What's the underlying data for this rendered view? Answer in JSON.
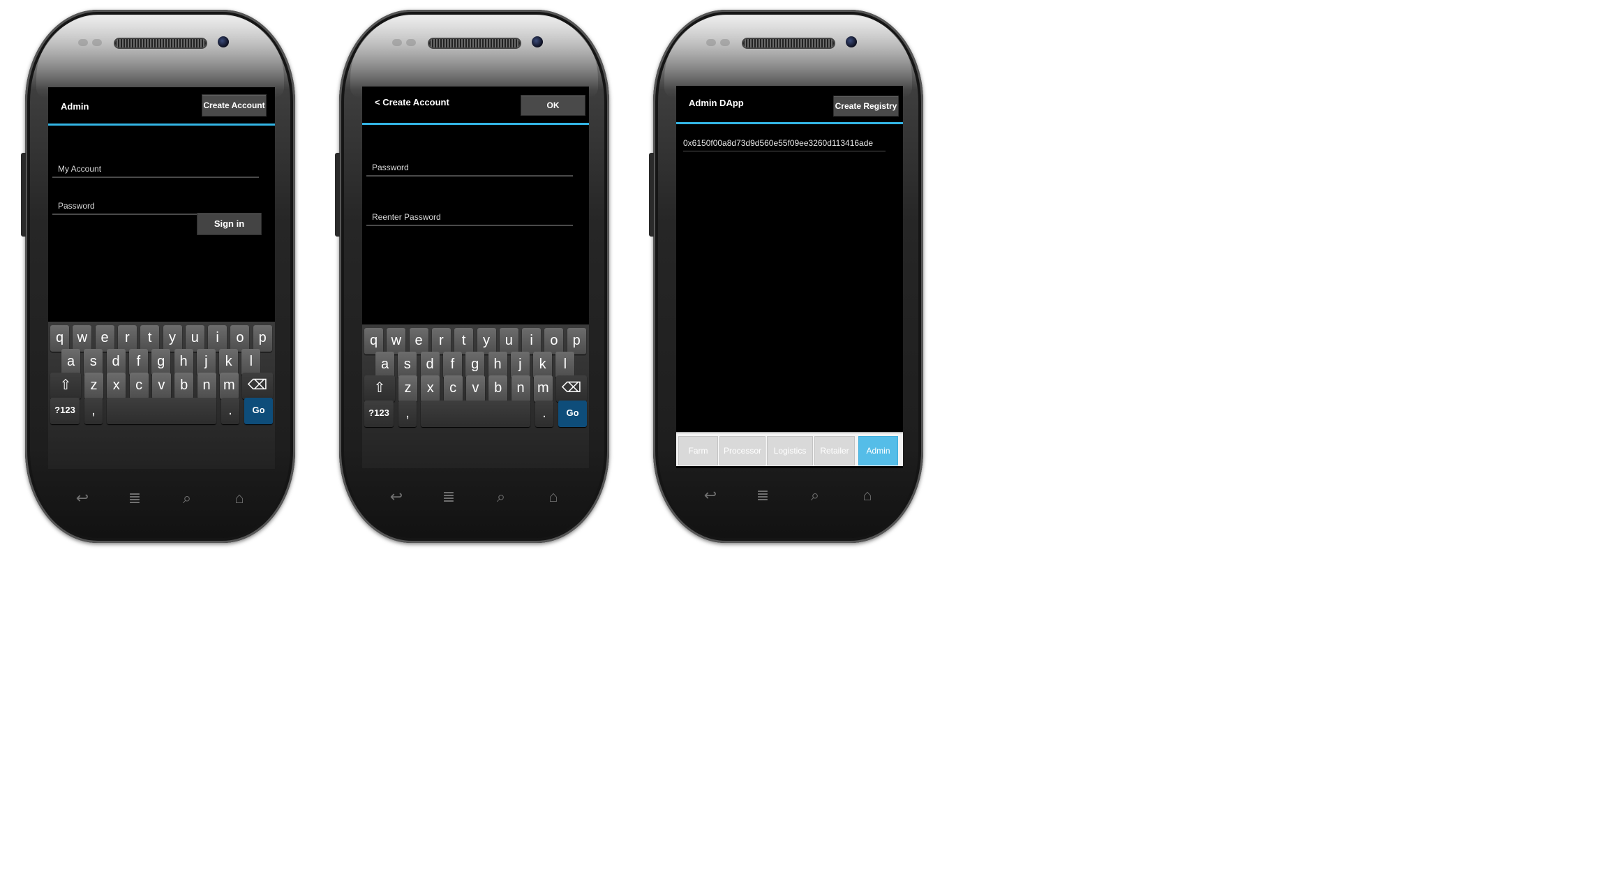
{
  "phone1": {
    "title": "Admin",
    "create_account_label": "Create Account",
    "account_placeholder": "My Account",
    "password_placeholder": "Password",
    "signin_label": "Sign in"
  },
  "phone2": {
    "title": "< Create Account",
    "ok_label": "OK",
    "password_placeholder": "Password",
    "reenter_placeholder": "Reenter Password"
  },
  "phone3": {
    "title": "Admin DApp",
    "create_registry_label": "Create Registry",
    "address": "0x6150f00a8d73d9d560e55f09ee3260d113416ade",
    "tabs": [
      "Farm",
      "Processor",
      "Logistics",
      "Retailer",
      "Admin"
    ],
    "active_tab": "Admin"
  },
  "keyboard": {
    "row1": [
      "q",
      "w",
      "e",
      "r",
      "t",
      "y",
      "u",
      "i",
      "o",
      "p"
    ],
    "row2": [
      "a",
      "s",
      "d",
      "f",
      "g",
      "h",
      "j",
      "k",
      "l"
    ],
    "row3": [
      "z",
      "x",
      "c",
      "v",
      "b",
      "n",
      "m"
    ],
    "shift_icon": "shift-icon",
    "backspace_icon": "backspace-icon",
    "symbols_label": "?123",
    "comma": ",",
    "period": ".",
    "go_label": "Go"
  },
  "nav_icons": [
    "back-icon",
    "menu-icon",
    "search-icon",
    "home-icon"
  ],
  "colors": {
    "accent": "#33b5e5",
    "go_key": "#0e4d7a",
    "active_tab": "#55bde8"
  }
}
